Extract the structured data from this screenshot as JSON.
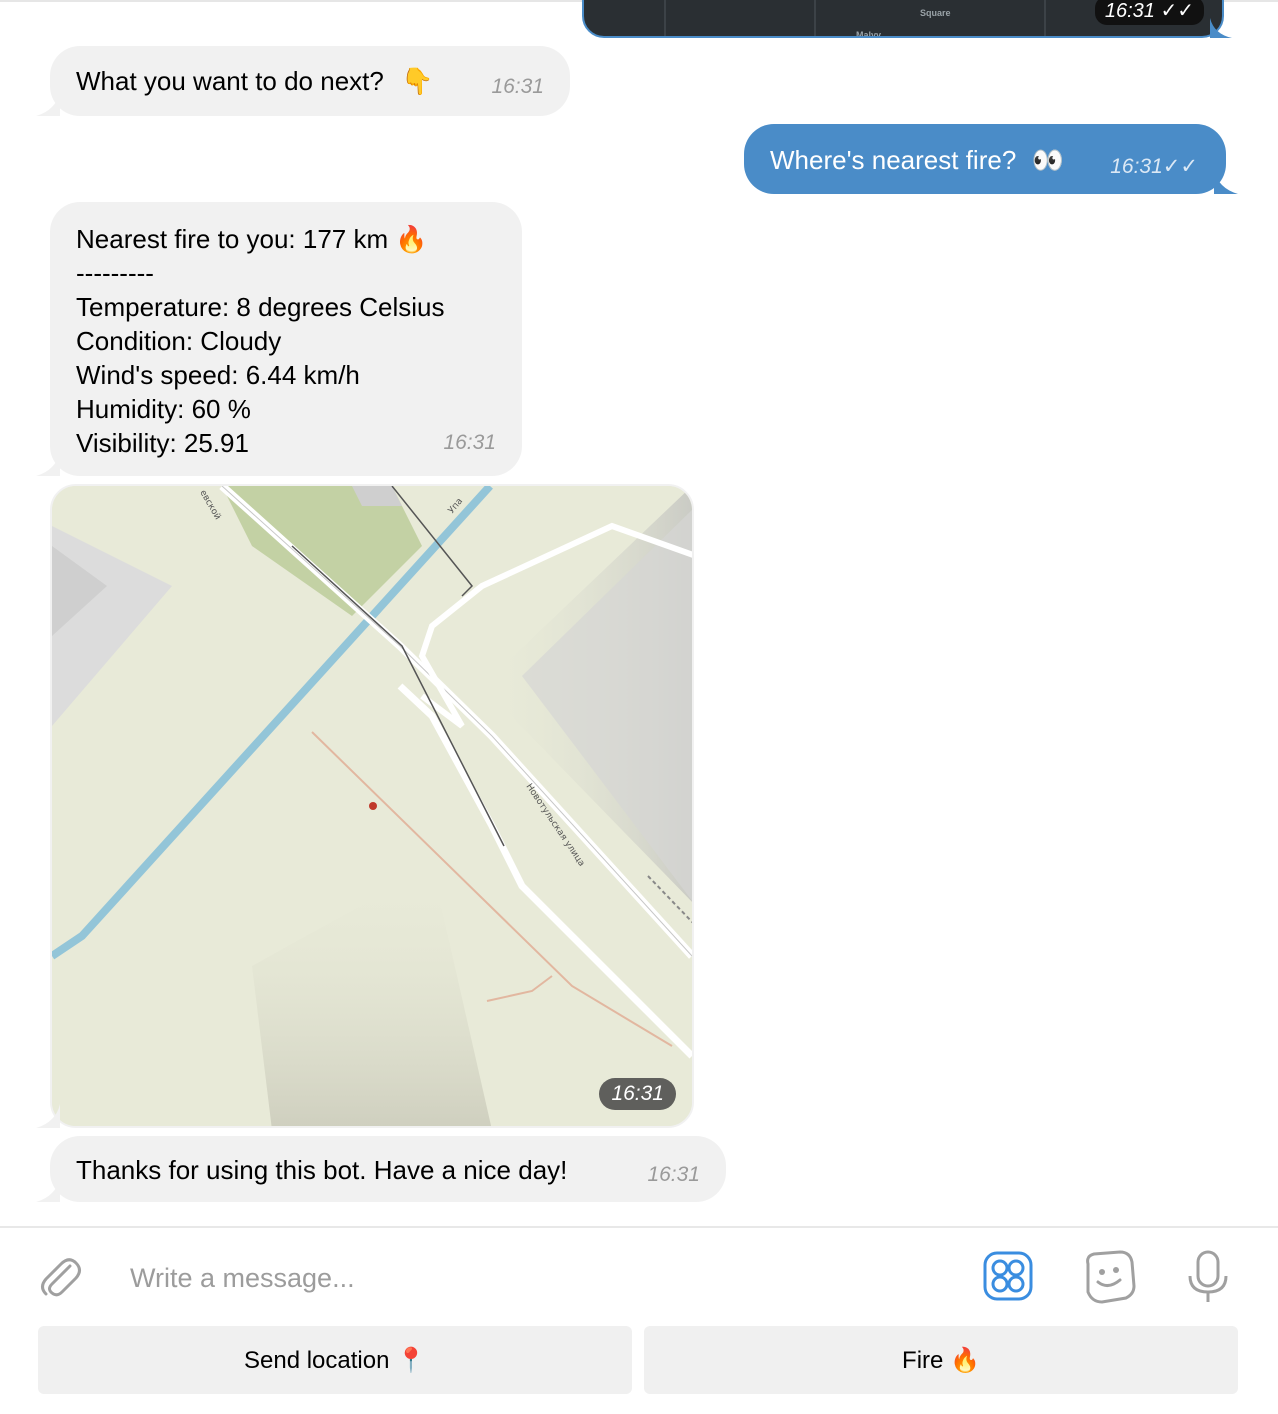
{
  "chat": {
    "top_map_time": "16:31",
    "top_map_labels": [
      "Square",
      "Malyy"
    ],
    "messages": [
      {
        "id": "m1",
        "direction": "in",
        "text": "What you want to do next?",
        "emoji": "👇",
        "time": "16:31"
      },
      {
        "id": "m2",
        "direction": "out",
        "text": "Where's nearest fire?",
        "emoji": "👀",
        "time": "16:31",
        "status": "read"
      },
      {
        "id": "m3",
        "direction": "in",
        "lines": [
          "Nearest fire to you: 177 km 🔥",
          "---------",
          "Temperature: 8 degrees Celsius",
          "Condition: Cloudy",
          "Wind's speed: 6.44 km/h",
          "Humidity: 60 %",
          "Visibility: 25.91"
        ],
        "time": "16:31"
      },
      {
        "id": "m4",
        "direction": "in",
        "type": "location",
        "time": "16:31",
        "map_labels": {
          "river": "Упа",
          "street": "Новотульская улица",
          "top_left": "евской"
        }
      },
      {
        "id": "m5",
        "direction": "in",
        "text": "Thanks for using this bot. Have a nice day!",
        "time": "16:31"
      }
    ]
  },
  "composer": {
    "placeholder": "Write a message..."
  },
  "reply_keyboard": {
    "buttons": [
      {
        "label": "Send location 📍"
      },
      {
        "label": "Fire 🔥"
      }
    ]
  },
  "colors": {
    "outgoing_bubble": "#4a8cc8",
    "incoming_bubble": "#f1f1f1",
    "accent": "#3a8de0"
  }
}
